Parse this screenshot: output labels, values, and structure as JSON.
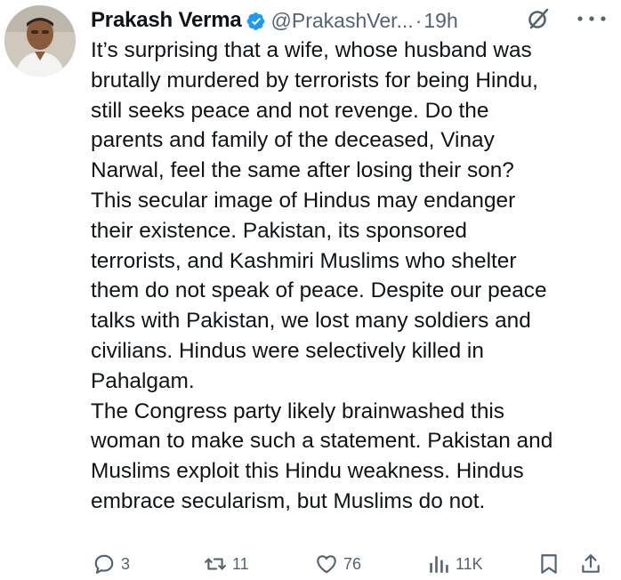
{
  "tweet": {
    "author": {
      "display_name": "Prakash Verma",
      "verified": true,
      "handle": "@PrakashVer...",
      "separator": "·",
      "time": "19h"
    },
    "text_lines": [
      "It’s surprising that a wife, whose husband was",
      "brutally murdered by terrorists for being Hindu,",
      "still seeks peace and not revenge. Do the",
      "parents and family of the deceased, Vinay",
      "Narwal, feel the same after losing their son?",
      "This secular image of Hindus may endanger",
      "their existence. Pakistan, its sponsored",
      "terrorists, and Kashmiri Muslims who shelter",
      "them do not speak of peace. Despite our peace",
      "talks with Pakistan, we lost many soldiers and",
      "civilians. Hindus were selectively killed in",
      "Pahalgam.",
      "The Congress party likely brainwashed this",
      "woman to make such a statement. Pakistan and",
      "Muslims exploit this Hindu weakness. Hindus",
      "embrace secularism, but Muslims do not."
    ]
  },
  "actions": {
    "replies": "3",
    "reposts": "11",
    "likes": "76",
    "views": "11K"
  },
  "icons": {
    "verified": "verified-badge-icon",
    "grok": "grok-icon",
    "more": "more-icon",
    "reply": "reply-icon",
    "repost": "repost-icon",
    "like": "heart-icon",
    "views": "views-icon",
    "bookmark": "bookmark-icon",
    "share": "share-icon"
  },
  "colors": {
    "text": "#0f1419",
    "muted": "#536471",
    "verified": "#1d9bf0"
  }
}
